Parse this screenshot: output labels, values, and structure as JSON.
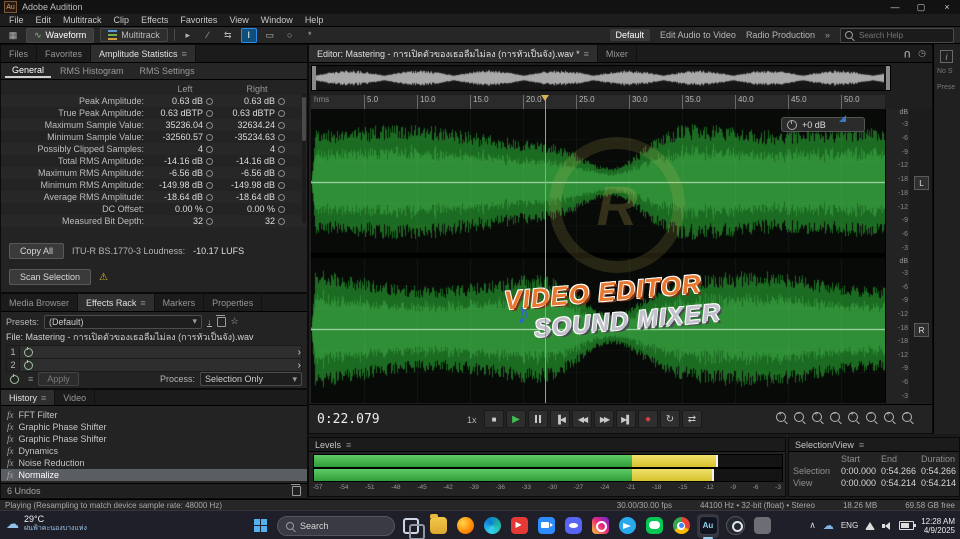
{
  "window": {
    "title": "Adobe Audition",
    "app_badge": "Au"
  },
  "menubar": {
    "items": [
      "File",
      "Edit",
      "Multitrack",
      "Clip",
      "Effects",
      "Favorites",
      "View",
      "Window",
      "Help"
    ]
  },
  "toolbar": {
    "waveform": "Waveform",
    "multitrack": "Multitrack",
    "workspaces": [
      "Default",
      "Edit Audio to Video",
      "Radio Production"
    ],
    "search_placeholder": "Search Help"
  },
  "stats": {
    "tabs": {
      "files": "Files",
      "favorites": "Favorites",
      "amplitude": "Amplitude Statistics"
    },
    "subtabs": {
      "general": "General",
      "histogram": "RMS Histogram",
      "settings": "RMS Settings"
    },
    "col_left": "Left",
    "col_right": "Right",
    "rows": [
      {
        "label": "Peak Amplitude:",
        "left": "0.63 dB",
        "right": "0.63 dB"
      },
      {
        "label": "True Peak Amplitude:",
        "left": "0.63 dBTP",
        "right": "0.63 dBTP"
      },
      {
        "label": "Maximum Sample Value:",
        "left": "35236.04",
        "right": "32634.24"
      },
      {
        "label": "Minimum Sample Value:",
        "left": "-32560.57",
        "right": "-35234.63"
      },
      {
        "label": "Possibly Clipped Samples:",
        "left": "4",
        "right": "4"
      },
      {
        "label": "Total RMS Amplitude:",
        "left": "-14.16 dB",
        "right": "-14.16 dB"
      },
      {
        "label": "Maximum RMS Amplitude:",
        "left": "-6.56 dB",
        "right": "-6.56 dB"
      },
      {
        "label": "Minimum RMS Amplitude:",
        "left": "-149.98 dB",
        "right": "-149.98 dB"
      },
      {
        "label": "Average RMS Amplitude:",
        "left": "-18.64 dB",
        "right": "-18.64 dB"
      },
      {
        "label": "DC Offset:",
        "left": "0.00 %",
        "right": "0.00 %"
      },
      {
        "label": "Measured Bit Depth:",
        "left": "32",
        "right": "32"
      }
    ],
    "copy_all": "Copy All",
    "loudness_label": "ITU-R BS.1770-3 Loudness:",
    "loudness_value": "-10.17 LUFS",
    "scan": "Scan Selection"
  },
  "rack": {
    "tabs": {
      "media": "Media Browser",
      "effects": "Effects Rack",
      "markers": "Markers",
      "properties": "Properties"
    },
    "presets_label": "Presets:",
    "preset": "(Default)",
    "file_line": "File: Mastering - การเปิดตัวของเธอลืมไม่ลง (การหัวเป็นจัง).wav",
    "slot1": "1",
    "slot2": "2",
    "apply": "Apply",
    "process_label": "Process:",
    "process": "Selection Only"
  },
  "history": {
    "tabs": {
      "history": "History",
      "video": "Video"
    },
    "items": [
      {
        "label": "FFT Filter"
      },
      {
        "label": "Graphic Phase Shifter"
      },
      {
        "label": "Graphic Phase Shifter"
      },
      {
        "label": "Dynamics"
      },
      {
        "label": "Noise Reduction"
      },
      {
        "label": "Normalize"
      }
    ],
    "undos": "6 Undos"
  },
  "editor": {
    "tab": "Editor: Mastering - การเปิดตัวของเธอลืมไม่ลง (การหัวเป็นจัง).wav *",
    "mixer": "Mixer",
    "ruler_unit": "hms",
    "ruler_ticks": [
      "5.0",
      "10.0",
      "15.0",
      "20.0",
      "25.0",
      "30.0",
      "35.0",
      "40.0",
      "45.0",
      "50.0"
    ],
    "db_unit": "dB",
    "db_scale_top": [
      "-3",
      "-6",
      "-9",
      "-12",
      "-18"
    ],
    "db_scale_bottom": [
      "-18",
      "-12",
      "-9",
      "-6",
      "-3"
    ],
    "left_badge": "L",
    "right_badge": "R",
    "hud": "+0 dB",
    "watermark1": "VIDEO EDITOR",
    "watermark2": "SOUND MIXER",
    "note": "♪"
  },
  "dock": {
    "info": "i",
    "line1": "No S",
    "line2": "Prese"
  },
  "transport": {
    "time": "0:22.079",
    "speed": "1x"
  },
  "levels": {
    "title": "Levels",
    "scale": [
      "-57",
      "-54",
      "-51",
      "-48",
      "-45",
      "-42",
      "-39",
      "-36",
      "-33",
      "-30",
      "-27",
      "-24",
      "-21",
      "-18",
      "-15",
      "-12",
      "-9",
      "-6",
      "-3"
    ],
    "meters": [
      {
        "green": 68,
        "yellow": 86
      },
      {
        "green": 68,
        "yellow": 85
      }
    ]
  },
  "selview": {
    "title": "Selection/View",
    "cols": [
      "Start",
      "End",
      "Duration"
    ],
    "selection_label": "Selection",
    "view_label": "View",
    "selection": [
      "0:00.000",
      "0:54.266",
      "0:54.266"
    ],
    "view": [
      "0:00.000",
      "0:54.214",
      "0:54.214"
    ]
  },
  "statusbar": {
    "left": "Playing (Resampling to match device sample rate: 48000 Hz)",
    "fps": "30.00/30.00 fps",
    "format": "44100 Hz • 32-bit (float) • Stereo",
    "size": "18.26 MB",
    "free": "69.58 GB free"
  },
  "taskbar": {
    "temp": "29°C",
    "weather": "ฝนฟ้าคะนองบางแห่ง",
    "search": "Search",
    "lang": "ENG",
    "time": "12:28 AM",
    "date": "4/9/2025"
  }
}
